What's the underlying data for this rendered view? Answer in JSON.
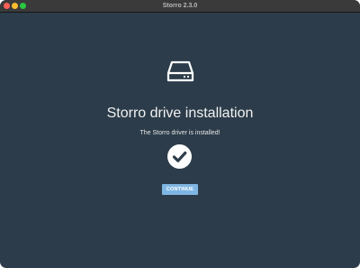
{
  "window": {
    "title": "Storro 2.3.0",
    "controls": {
      "close": "close-button",
      "minimize": "minimize-button",
      "zoom": "zoom-button"
    }
  },
  "main": {
    "icon": "hard-drive-icon",
    "heading": "Storro drive installation",
    "status": "The Storro driver is installed!",
    "status_icon": "checkmark-circle-icon",
    "continue_label": "CONTINUE"
  },
  "colors": {
    "background": "#2c3c4a",
    "titlebar": "#3a3a3a",
    "button": "#7fb6e3",
    "text": "#f2f2f2"
  }
}
